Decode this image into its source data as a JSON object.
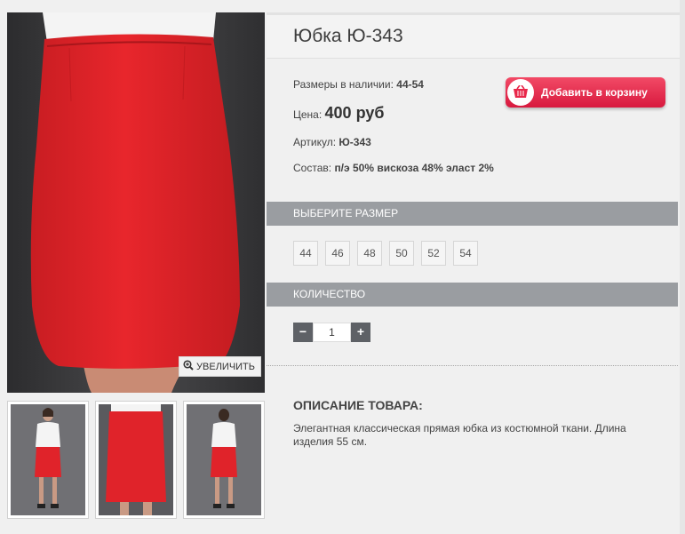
{
  "product": {
    "title": "Юбка Ю-343",
    "sizes_label": "Размеры в наличии:",
    "sizes_value": "44-54",
    "price_label": "Цена:",
    "price_value": "400 руб",
    "sku_label": "Артикул:",
    "sku_value": "Ю-343",
    "composition_label": "Состав:",
    "composition_value": "п/э 50% вискоза 48% эласт 2%"
  },
  "cart_button": {
    "label": "Добавить в корзину",
    "icon": "basket-icon",
    "color": "#e8274a"
  },
  "gallery": {
    "zoom_label": "УВЕЛИЧИТЬ",
    "zoom_icon": "magnifier-plus-icon",
    "thumbnail_count": 3
  },
  "size_section": {
    "header": "ВЫБЕРИТЕ РАЗМЕР",
    "options": [
      "44",
      "46",
      "48",
      "50",
      "52",
      "54"
    ]
  },
  "quantity_section": {
    "header": "КОЛИЧЕСТВО",
    "minus_label": "−",
    "plus_label": "+",
    "value": "1"
  },
  "description": {
    "title": "ОПИСАНИЕ ТОВАРА:",
    "text": "Элегантная классическая прямая юбка из костюмной ткани. Длина изделия 55 см."
  },
  "colors": {
    "section_bar": "#9a9da1",
    "skirt_red": "#e0232a",
    "cart_button": "#e8274a",
    "qty_button": "#5e6166"
  }
}
